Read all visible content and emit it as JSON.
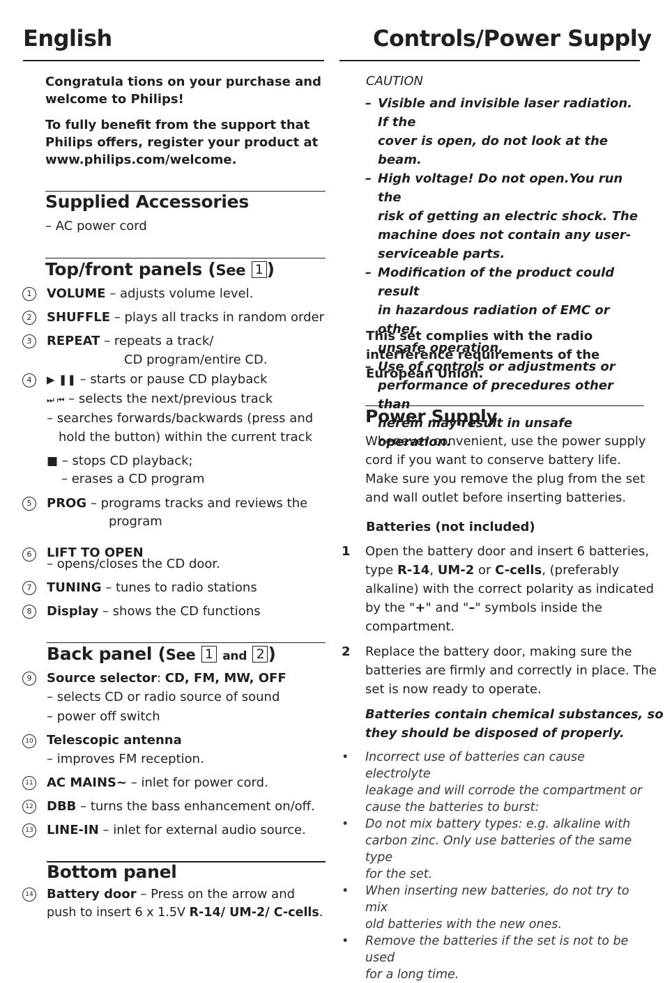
{
  "header": {
    "left_title": "English",
    "right_title": "Controls/Power Supply"
  },
  "intro": {
    "line1": "Congratula tions on your purchase and",
    "line2": "welcome to Philips!",
    "line3": "To fully benefit from the support that",
    "line4": "Philips offers, register your product at",
    "line5": "www.philips.com/welcome."
  },
  "supplied_accessories": {
    "title": "Supplied Accessories",
    "items": [
      "– AC power cord"
    ]
  },
  "top_front_panels": {
    "title": "Top/front panels (",
    "see": "See",
    "fig": "1",
    "close": ")",
    "items": [
      {
        "num": "1",
        "label": "VOLUME",
        "desc": " – adjusts volume level."
      },
      {
        "num": "2",
        "label": "SHUFFLE",
        "desc": " – plays all tracks in random order"
      },
      {
        "num": "3",
        "label": "REPEAT",
        "desc": " – repeats a track/",
        "desc2": "CD program/entire CD."
      },
      {
        "num": "4",
        "play_pause": "▶ ❚❚",
        "desc": " – starts or pause CD playback",
        "skip": "⏭ ⏮",
        "skip_desc": " – selects the next/previous track",
        "search1": "– searches forwards/backwards (press and",
        "search2": "hold the button) within the current track",
        "stop": "■",
        "stop_desc": " – stops CD playback;",
        "erase": "– erases a CD program"
      },
      {
        "num": "5",
        "label": "PROG",
        "desc": " – programs tracks and reviews the",
        "desc2": "program"
      },
      {
        "num": "6",
        "label": "LIFT TO OPEN",
        "desc2": "– opens/closes the CD door."
      },
      {
        "num": "7",
        "label": "TUNING",
        "desc": " – tunes to radio stations"
      },
      {
        "num": "8",
        "label": "Display",
        "desc": " – shows the CD functions"
      }
    ]
  },
  "back_panel": {
    "title": "Back panel (",
    "see": "See",
    "fig1": "1",
    "and": "and",
    "fig2": "2",
    "close": ")",
    "items": [
      {
        "num": "9",
        "label": "Source selector",
        "sep": ": ",
        "label2": "CD, FM, MW, OFF",
        "desc2": "– selects CD or radio source of sound",
        "desc3": "– power off switch"
      },
      {
        "num": "10",
        "label": "Telescopic antenna",
        "desc2": "– improves FM reception."
      },
      {
        "num": "11",
        "label": "AC MAINS~",
        "desc": " – inlet for power cord."
      },
      {
        "num": "12",
        "label": "DBB",
        "desc": " – turns the bass enhancement on/off."
      },
      {
        "num": "13",
        "label": "LINE-IN",
        "desc": " – inlet for external audio source."
      }
    ]
  },
  "bottom_panel": {
    "title": "Bottom panel",
    "items": [
      {
        "num": "14",
        "label": "Battery door",
        "desc": " – Press on the arrow and",
        "desc2": "push to insert 6 x 1.5V ",
        "b1": "R-14",
        "s1": "/ ",
        "b2": "UM-2",
        "s2": "/ ",
        "b3": "C-cells",
        "end": "."
      }
    ]
  },
  "caution": {
    "title": "CAUTION",
    "items": [
      [
        "Visible and invisible laser radiation. If the",
        "cover is open, do not look at the beam."
      ],
      [
        "High voltage! Do not open.You run the",
        "risk of getting an electric shock. The",
        "machine does not contain any user-",
        "serviceable parts."
      ],
      [
        "Modification of the product could result",
        "in hazardous radiation of EMC or other",
        "unsafe operation."
      ],
      [
        "Use of controls or adjustments or",
        "performance of precedures other than",
        "herein may result in unsafe operation."
      ]
    ],
    "compliance": [
      "This set complies with the radio",
      "interference requirements of the",
      "European Union."
    ]
  },
  "power_supply": {
    "title": "Power Supply",
    "body": [
      "Whenever convenient, use the power supply",
      "cord if you want to conserve battery life.",
      "Make sure you remove the plug from the set",
      "and wall outlet before inserting batteries."
    ],
    "batteries_heading": "Batteries (not included)",
    "steps": [
      {
        "num": "1",
        "l1": "Open the battery door and insert 6 batteries,",
        "l2a": "type ",
        "l2b": "R-14",
        "l2c": ", ",
        "l2d": "UM-2",
        "l2e": " or ",
        "l2f": "C-cells",
        "l2g": ", (preferably",
        "l3": "alkaline) with the correct polarity as indicated",
        "l4a": "by the \"",
        "l4b": "+",
        "l4c": "\" and \"",
        "l4d": "–",
        "l4e": "\" symbols inside the",
        "l5": "compartment."
      },
      {
        "num": "2",
        "lines": [
          "Replace the battery door, making sure the",
          "batteries are firmly and correctly in place. The",
          "set is now ready to operate."
        ]
      }
    ],
    "warning": [
      "Batteries contain chemical substances, so",
      "they should be disposed of properly."
    ],
    "bullets": [
      [
        "Incorrect use of batteries can cause electrolyte",
        "leakage and will corrode the compartment or",
        "cause the batteries to burst:"
      ],
      [
        "Do not mix battery types: e.g. alkaline with",
        "carbon zinc. Only use batteries of the same type",
        "for the set."
      ],
      [
        "When inserting new batteries, do not try to mix",
        "old batteries with the new ones."
      ],
      [
        "Remove the batteries if the set is not to be used",
        "for a long time."
      ]
    ],
    "bullet_glyph": "•"
  }
}
